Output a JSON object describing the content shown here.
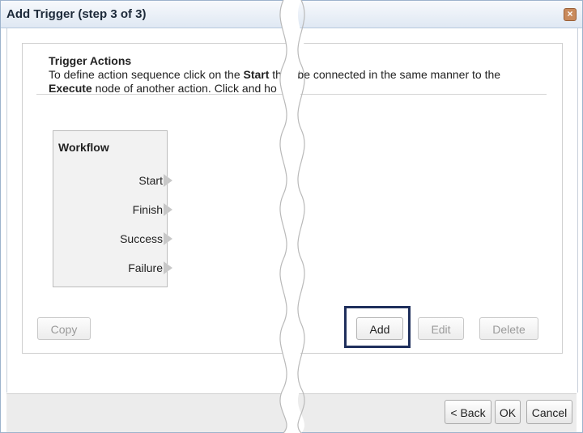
{
  "dialog": {
    "title": "Add Trigger (step 3 of 3)",
    "close_symbol": "×"
  },
  "panel": {
    "title": "Trigger Actions",
    "desc_line1_a": "To define action sequence click on the ",
    "desc_line1_b": "Start",
    "desc_line1_c": " then be connected in the same manner to the",
    "desc_line2_a": "Execute",
    "desc_line2_b": " node of another action. Click and ho"
  },
  "workflow": {
    "title": "Workflow",
    "ports": [
      "Start",
      "Finish",
      "Success",
      "Failure"
    ]
  },
  "actions": {
    "copy": "Copy",
    "add": "Add",
    "edit": "Edit",
    "delete": "Delete"
  },
  "footer": {
    "back": "< Back",
    "ok": "OK",
    "cancel": "Cancel"
  },
  "colors": {
    "highlight": "#1f2f5c",
    "title_bar": "#dfe8f3"
  },
  "icons": {
    "close": "close-icon",
    "port": "triangle-right-icon"
  }
}
